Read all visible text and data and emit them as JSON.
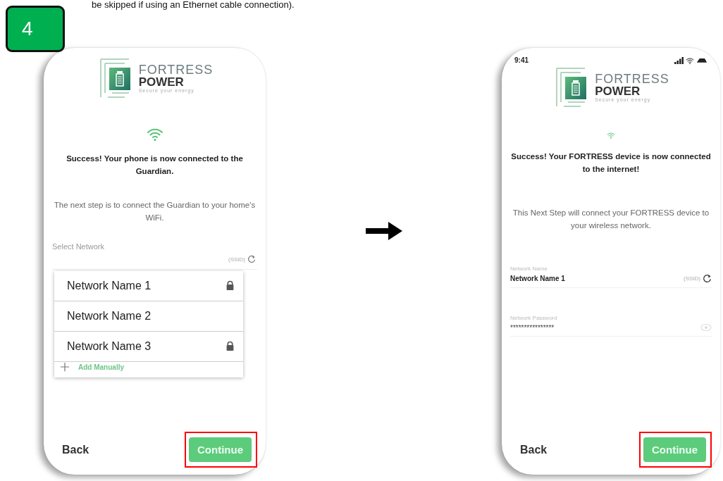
{
  "document": {
    "text_line": "be skipped if using an Ethernet cable connection).",
    "step_badge": "4"
  },
  "left_screen": {
    "logo": {
      "name_top": "FORTRESS",
      "name_bottom": "POWER",
      "tagline": "Secure your energy"
    },
    "success_text": "Success! Your phone is now connected to the Guardian.",
    "next_step_text": "The next step is to connect the Guardian to your home's WiFi.",
    "select_label": "Select Network",
    "ssid_label": "(SSID)",
    "networks": [
      {
        "name": "Network Name 1",
        "locked": true
      },
      {
        "name": "Network Name 2",
        "locked": false
      },
      {
        "name": "Network Name 3",
        "locked": true
      }
    ],
    "add_label": "Add Manually",
    "back": "Back",
    "continue": "Continue",
    "continue_highlighted": true
  },
  "right_screen": {
    "status_time": "9:41",
    "logo": {
      "name_top": "FORTRESS",
      "name_bottom": "POWER",
      "tagline": "Secure your energy"
    },
    "success_text": "Success! Your FORTRESS device is now connected to the internet!",
    "next_step_text": "This Next Step will connect your FORTRESS device to your wireless network.",
    "fields": [
      {
        "kind": "select",
        "label": "Network Name",
        "value": "Network Name 1",
        "suffix": "(SSID)"
      },
      {
        "kind": "password",
        "label": "Network Password",
        "value": "****************"
      }
    ],
    "back": "Back",
    "continue": "Continue",
    "continue_highlighted": true
  }
}
